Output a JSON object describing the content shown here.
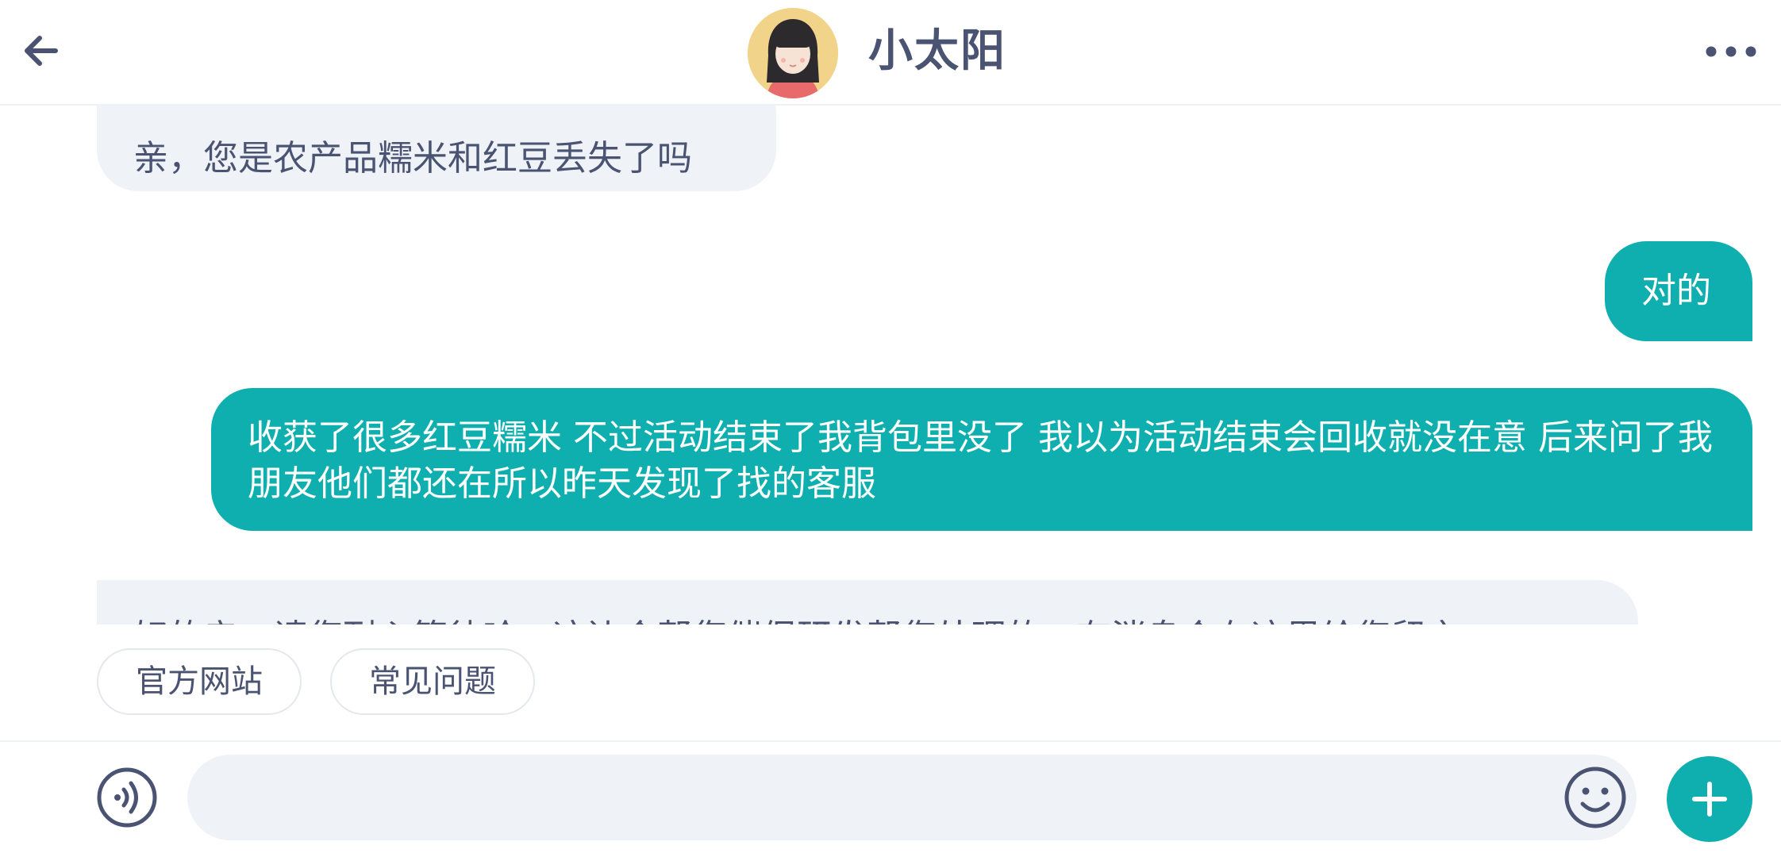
{
  "header": {
    "title": "小太阳",
    "back_icon": "arrow-left-icon",
    "more_icon": "more-horizontal-icon"
  },
  "messages": [
    {
      "direction": "incoming",
      "text": "亲，您是农产品糯米和红豆丢失了吗"
    },
    {
      "direction": "outgoing",
      "text": "对的"
    },
    {
      "direction": "outgoing",
      "text": "收获了很多红豆糯米 不过活动结束了我背包里没了 我以为活动结束会回收就没在意 后来问了我朋友他们都还在所以昨天发现了找的客服"
    },
    {
      "direction": "incoming",
      "text": "好的亲，请您耐心等待哈，这边会帮您催促研发帮您处理的，有消息会在这里给您留言"
    }
  ],
  "quick_replies": [
    "官方网站",
    "常见问题"
  ],
  "input": {
    "value": "",
    "placeholder": "",
    "voice_icon": "voice-icon",
    "emoji_icon": "emoji-icon",
    "plus_icon": "plus-icon"
  },
  "colors": {
    "accent": "#0fafaf",
    "incoming_bubble": "#eff3f7",
    "text_dark": "#4a5372"
  }
}
